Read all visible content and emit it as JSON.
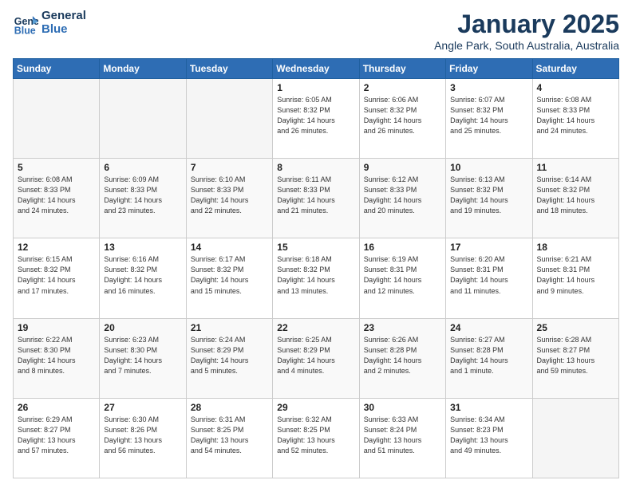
{
  "logo": {
    "line1": "General",
    "line2": "Blue"
  },
  "title": "January 2025",
  "subtitle": "Angle Park, South Australia, Australia",
  "headers": [
    "Sunday",
    "Monday",
    "Tuesday",
    "Wednesday",
    "Thursday",
    "Friday",
    "Saturday"
  ],
  "weeks": [
    [
      {
        "day": "",
        "info": ""
      },
      {
        "day": "",
        "info": ""
      },
      {
        "day": "",
        "info": ""
      },
      {
        "day": "1",
        "info": "Sunrise: 6:05 AM\nSunset: 8:32 PM\nDaylight: 14 hours\nand 26 minutes."
      },
      {
        "day": "2",
        "info": "Sunrise: 6:06 AM\nSunset: 8:32 PM\nDaylight: 14 hours\nand 26 minutes."
      },
      {
        "day": "3",
        "info": "Sunrise: 6:07 AM\nSunset: 8:32 PM\nDaylight: 14 hours\nand 25 minutes."
      },
      {
        "day": "4",
        "info": "Sunrise: 6:08 AM\nSunset: 8:33 PM\nDaylight: 14 hours\nand 24 minutes."
      }
    ],
    [
      {
        "day": "5",
        "info": "Sunrise: 6:08 AM\nSunset: 8:33 PM\nDaylight: 14 hours\nand 24 minutes."
      },
      {
        "day": "6",
        "info": "Sunrise: 6:09 AM\nSunset: 8:33 PM\nDaylight: 14 hours\nand 23 minutes."
      },
      {
        "day": "7",
        "info": "Sunrise: 6:10 AM\nSunset: 8:33 PM\nDaylight: 14 hours\nand 22 minutes."
      },
      {
        "day": "8",
        "info": "Sunrise: 6:11 AM\nSunset: 8:33 PM\nDaylight: 14 hours\nand 21 minutes."
      },
      {
        "day": "9",
        "info": "Sunrise: 6:12 AM\nSunset: 8:33 PM\nDaylight: 14 hours\nand 20 minutes."
      },
      {
        "day": "10",
        "info": "Sunrise: 6:13 AM\nSunset: 8:32 PM\nDaylight: 14 hours\nand 19 minutes."
      },
      {
        "day": "11",
        "info": "Sunrise: 6:14 AM\nSunset: 8:32 PM\nDaylight: 14 hours\nand 18 minutes."
      }
    ],
    [
      {
        "day": "12",
        "info": "Sunrise: 6:15 AM\nSunset: 8:32 PM\nDaylight: 14 hours\nand 17 minutes."
      },
      {
        "day": "13",
        "info": "Sunrise: 6:16 AM\nSunset: 8:32 PM\nDaylight: 14 hours\nand 16 minutes."
      },
      {
        "day": "14",
        "info": "Sunrise: 6:17 AM\nSunset: 8:32 PM\nDaylight: 14 hours\nand 15 minutes."
      },
      {
        "day": "15",
        "info": "Sunrise: 6:18 AM\nSunset: 8:32 PM\nDaylight: 14 hours\nand 13 minutes."
      },
      {
        "day": "16",
        "info": "Sunrise: 6:19 AM\nSunset: 8:31 PM\nDaylight: 14 hours\nand 12 minutes."
      },
      {
        "day": "17",
        "info": "Sunrise: 6:20 AM\nSunset: 8:31 PM\nDaylight: 14 hours\nand 11 minutes."
      },
      {
        "day": "18",
        "info": "Sunrise: 6:21 AM\nSunset: 8:31 PM\nDaylight: 14 hours\nand 9 minutes."
      }
    ],
    [
      {
        "day": "19",
        "info": "Sunrise: 6:22 AM\nSunset: 8:30 PM\nDaylight: 14 hours\nand 8 minutes."
      },
      {
        "day": "20",
        "info": "Sunrise: 6:23 AM\nSunset: 8:30 PM\nDaylight: 14 hours\nand 7 minutes."
      },
      {
        "day": "21",
        "info": "Sunrise: 6:24 AM\nSunset: 8:29 PM\nDaylight: 14 hours\nand 5 minutes."
      },
      {
        "day": "22",
        "info": "Sunrise: 6:25 AM\nSunset: 8:29 PM\nDaylight: 14 hours\nand 4 minutes."
      },
      {
        "day": "23",
        "info": "Sunrise: 6:26 AM\nSunset: 8:28 PM\nDaylight: 14 hours\nand 2 minutes."
      },
      {
        "day": "24",
        "info": "Sunrise: 6:27 AM\nSunset: 8:28 PM\nDaylight: 14 hours\nand 1 minute."
      },
      {
        "day": "25",
        "info": "Sunrise: 6:28 AM\nSunset: 8:27 PM\nDaylight: 13 hours\nand 59 minutes."
      }
    ],
    [
      {
        "day": "26",
        "info": "Sunrise: 6:29 AM\nSunset: 8:27 PM\nDaylight: 13 hours\nand 57 minutes."
      },
      {
        "day": "27",
        "info": "Sunrise: 6:30 AM\nSunset: 8:26 PM\nDaylight: 13 hours\nand 56 minutes."
      },
      {
        "day": "28",
        "info": "Sunrise: 6:31 AM\nSunset: 8:25 PM\nDaylight: 13 hours\nand 54 minutes."
      },
      {
        "day": "29",
        "info": "Sunrise: 6:32 AM\nSunset: 8:25 PM\nDaylight: 13 hours\nand 52 minutes."
      },
      {
        "day": "30",
        "info": "Sunrise: 6:33 AM\nSunset: 8:24 PM\nDaylight: 13 hours\nand 51 minutes."
      },
      {
        "day": "31",
        "info": "Sunrise: 6:34 AM\nSunset: 8:23 PM\nDaylight: 13 hours\nand 49 minutes."
      },
      {
        "day": "",
        "info": ""
      }
    ]
  ]
}
